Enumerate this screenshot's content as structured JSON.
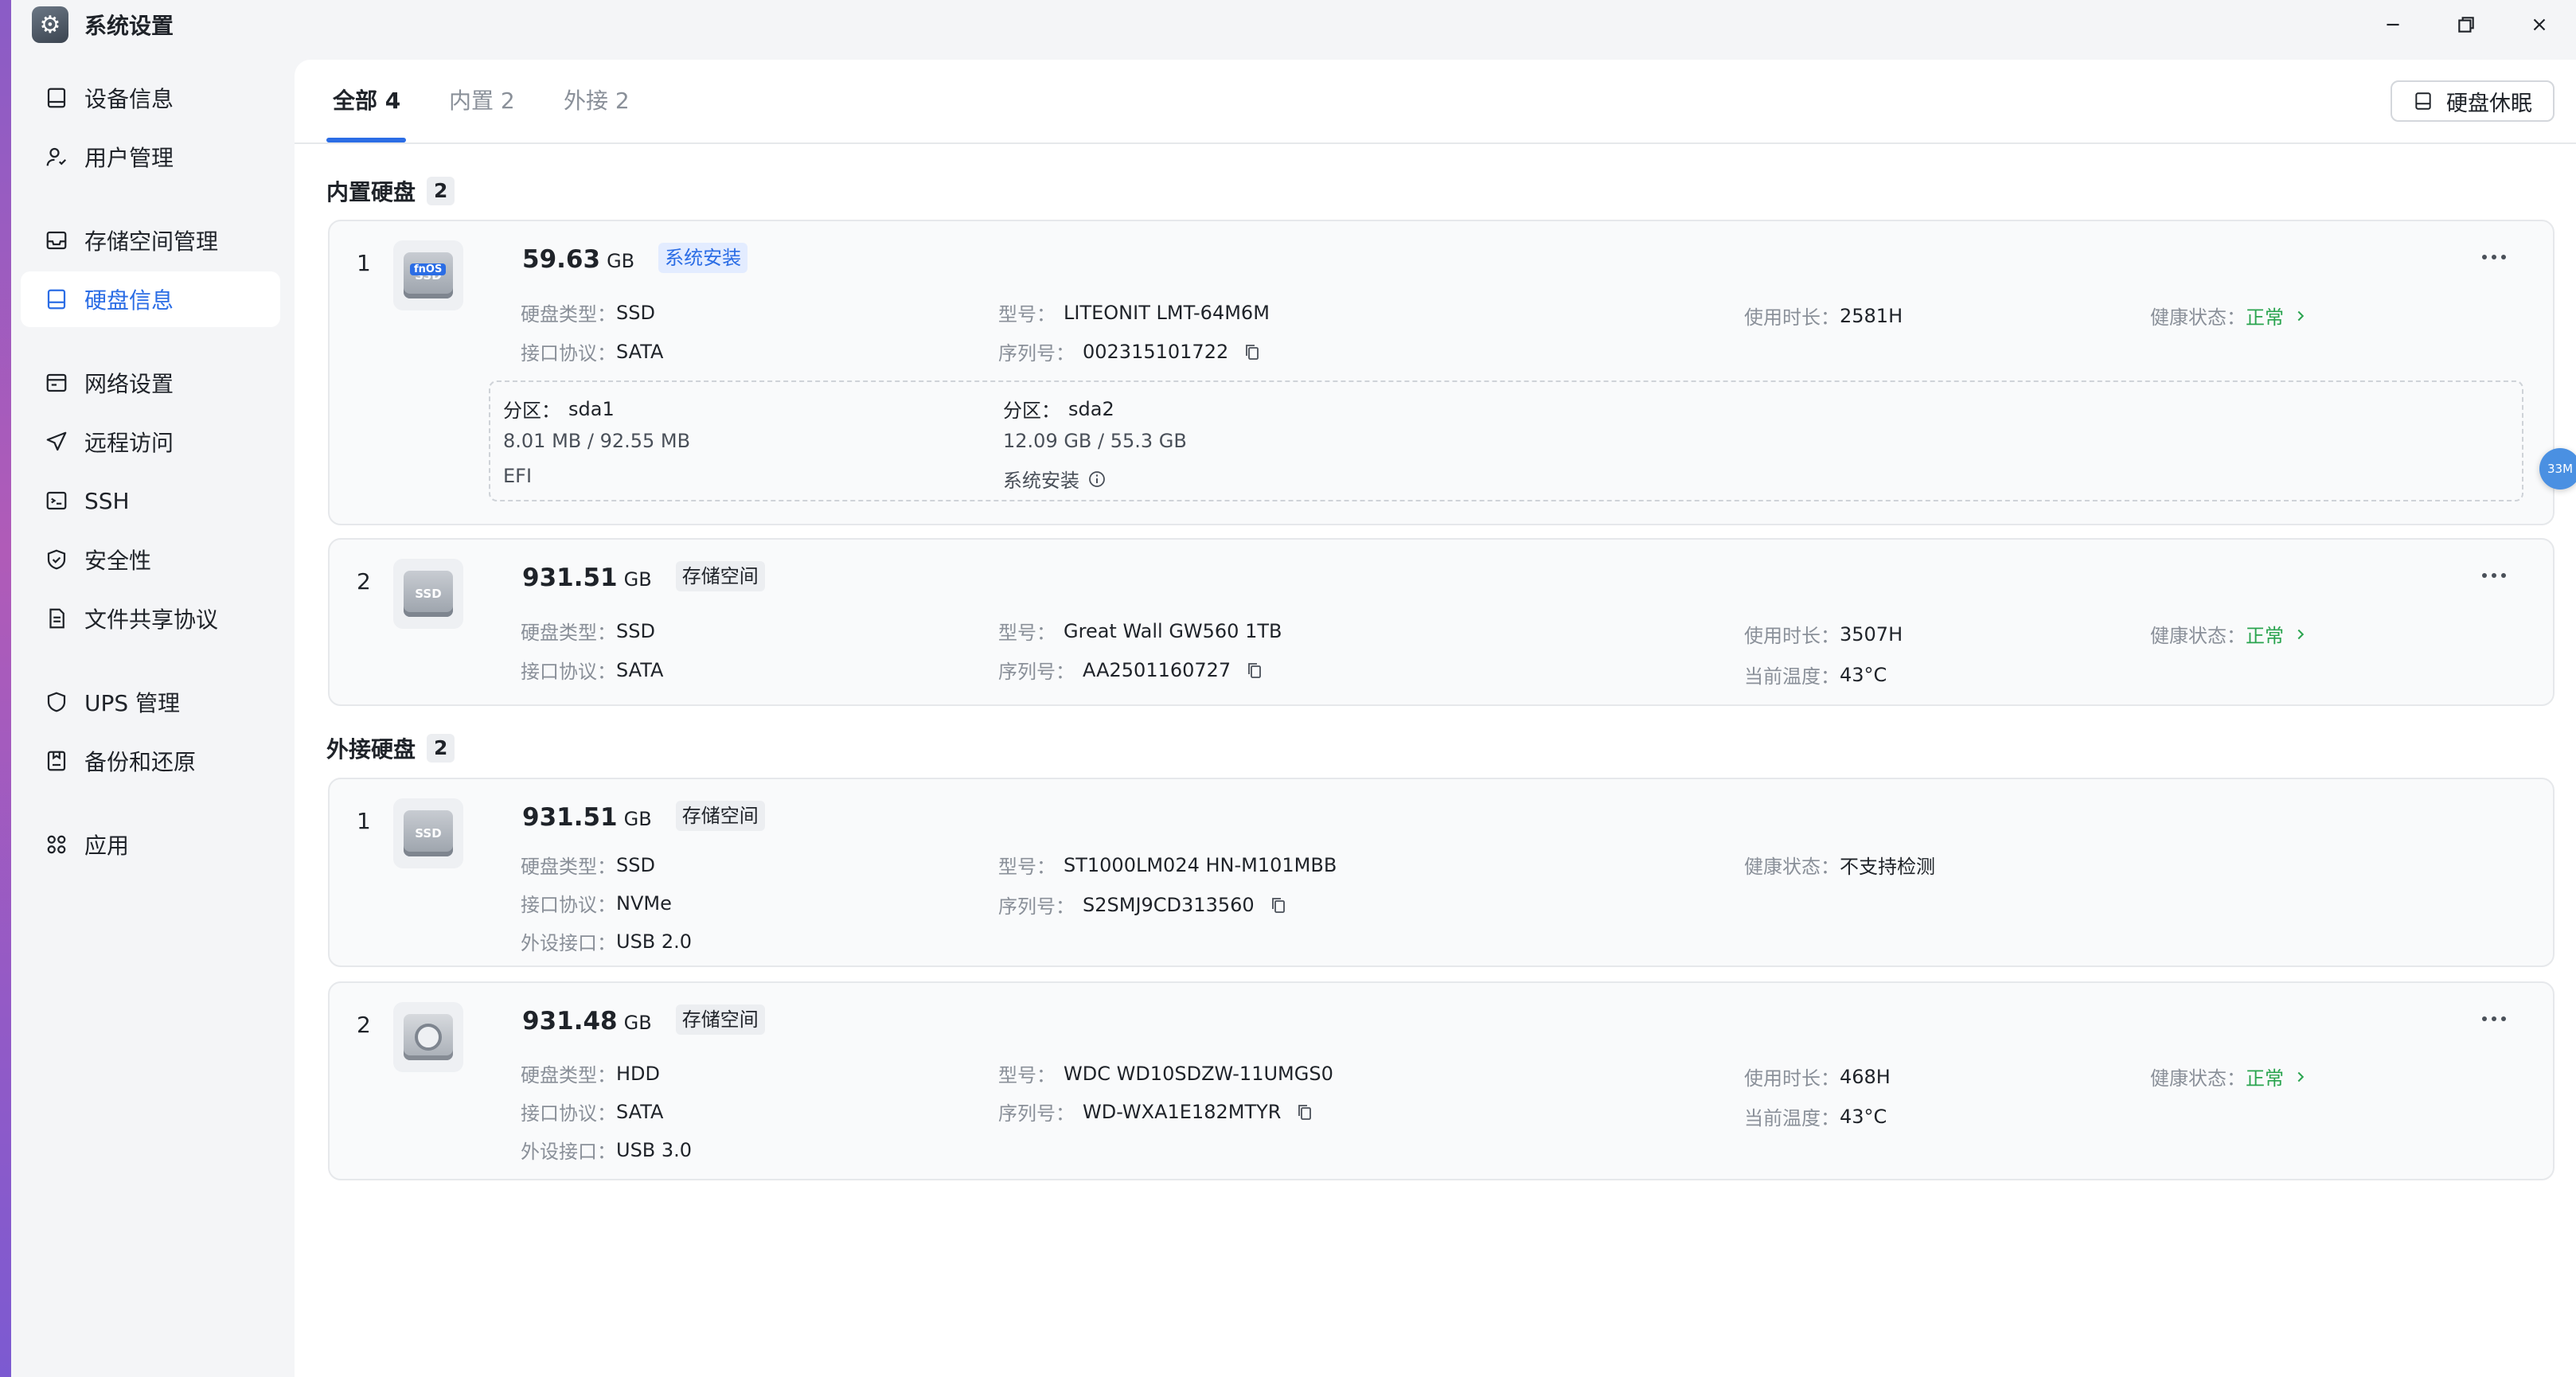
{
  "window": {
    "title": "系统设置",
    "icon": "gear-icon"
  },
  "sidebar": {
    "items": [
      {
        "label": "设备信息",
        "icon": "device-info-icon"
      },
      {
        "label": "用户管理",
        "icon": "user-icon"
      },
      {
        "label": "存储空间管理",
        "icon": "storage-icon"
      },
      {
        "label": "硬盘信息",
        "icon": "disk-icon",
        "active": true
      },
      {
        "label": "网络设置",
        "icon": "network-icon"
      },
      {
        "label": "远程访问",
        "icon": "send-icon"
      },
      {
        "label": "SSH",
        "icon": "terminal-icon"
      },
      {
        "label": "安全性",
        "icon": "shield-icon"
      },
      {
        "label": "文件共享协议",
        "icon": "document-icon"
      },
      {
        "label": "UPS 管理",
        "icon": "ups-shield-icon"
      },
      {
        "label": "备份和还原",
        "icon": "backup-icon"
      },
      {
        "label": "应用",
        "icon": "apps-icon"
      }
    ]
  },
  "tabs": [
    {
      "label": "全部 4",
      "active": true
    },
    {
      "label": "内置 2"
    },
    {
      "label": "外接 2"
    }
  ],
  "sleep_button": "硬盘休眠",
  "internal": {
    "title": "内置硬盘",
    "count": "2",
    "disks": [
      {
        "index": "1",
        "capacity": "59.63",
        "unit": "GB",
        "tag": "系统安装",
        "logo": "fnOS",
        "type_label": "硬盘类型：",
        "type": "SSD",
        "iface_label": "接口协议：",
        "iface": "SATA",
        "model_label": "型号：",
        "model": "LITEONIT LMT-64M6M",
        "serial_label": "序列号：",
        "serial": "002315101722",
        "hours_label": "使用时长：",
        "hours": "2581H",
        "health_label": "健康状态：",
        "health": "正常",
        "partitions": [
          {
            "label": "分区：",
            "name": "sda1",
            "usage": "8.01 MB / 92.55 MB",
            "desc": "EFI"
          },
          {
            "label": "分区：",
            "name": "sda2",
            "usage": "12.09 GB / 55.3 GB",
            "desc": "系统安装"
          }
        ]
      },
      {
        "index": "2",
        "capacity": "931.51",
        "unit": "GB",
        "tag": "存储空间",
        "type_label": "硬盘类型：",
        "type": "SSD",
        "iface_label": "接口协议：",
        "iface": "SATA",
        "model_label": "型号：",
        "model": "Great Wall GW560 1TB",
        "serial_label": "序列号：",
        "serial": "AA2501160727",
        "hours_label": "使用时长：",
        "hours": "3507H",
        "temp_label": "当前温度：",
        "temp": "43°C",
        "health_label": "健康状态：",
        "health": "正常"
      }
    ]
  },
  "external": {
    "title": "外接硬盘",
    "count": "2",
    "disks": [
      {
        "index": "1",
        "capacity": "931.51",
        "unit": "GB",
        "tag": "存储空间",
        "type_label": "硬盘类型：",
        "type": "SSD",
        "iface_label": "接口协议：",
        "iface": "NVMe",
        "port_label": "外设接口：",
        "port": "USB 2.0",
        "model_label": "型号：",
        "model": "ST1000LM024 HN-M101MBB",
        "serial_label": "序列号：",
        "serial": "S2SMJ9CD313560",
        "health_label": "健康状态：",
        "health": "不支持检测"
      },
      {
        "index": "2",
        "capacity": "931.48",
        "unit": "GB",
        "tag": "存储空间",
        "type_label": "硬盘类型：",
        "type": "HDD",
        "iface_label": "接口协议：",
        "iface": "SATA",
        "port_label": "外设接口：",
        "port": "USB 3.0",
        "model_label": "型号：",
        "model": "WDC WD10SDZW-11UMGS0",
        "serial_label": "序列号：",
        "serial": "WD-WXA1E182MTYR",
        "hours_label": "使用时长：",
        "hours": "468H",
        "temp_label": "当前温度：",
        "temp": "43°C",
        "health_label": "健康状态：",
        "health": "正常"
      }
    ]
  },
  "floating_badge": "33M",
  "colors": {
    "accent": "#2b6de5",
    "healthy": "#2aa44f",
    "muted": "#8a9099"
  }
}
